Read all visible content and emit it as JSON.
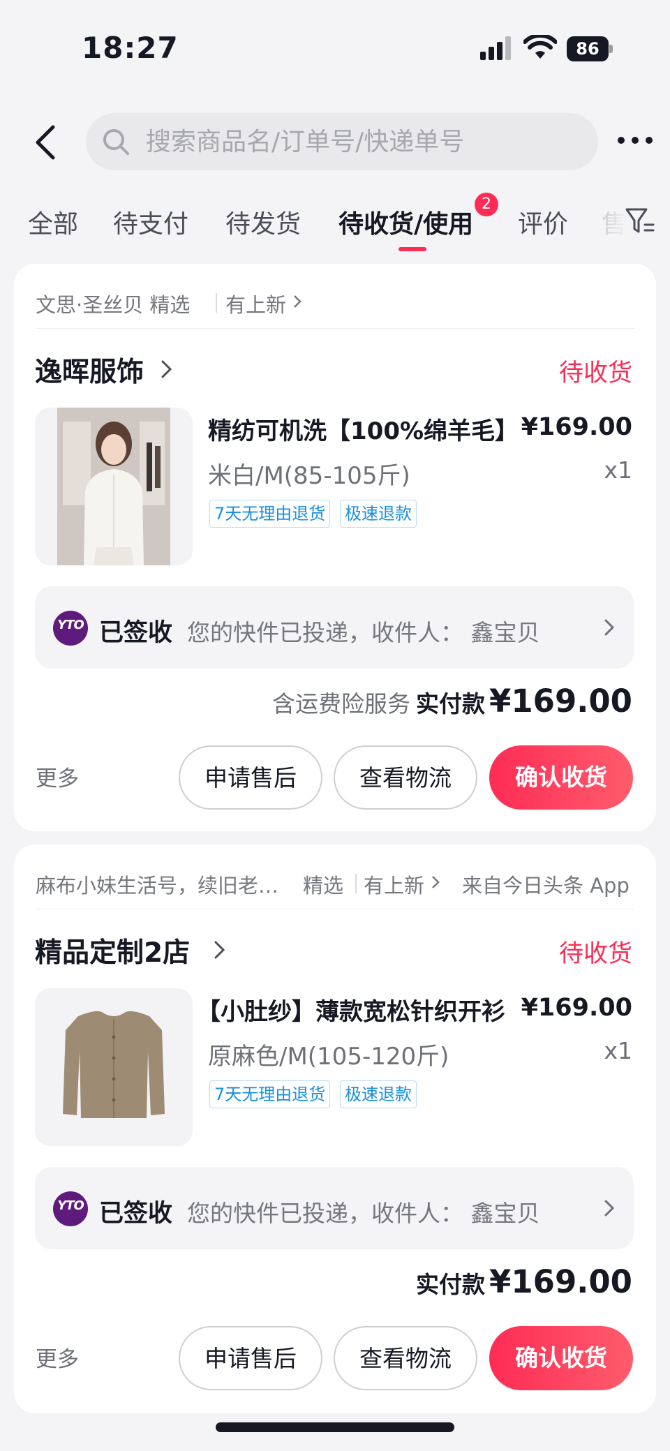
{
  "status_bar": {
    "time": "18:27",
    "battery": "86"
  },
  "search": {
    "placeholder": "搜索商品名/订单号/快递单号",
    "value": ""
  },
  "tabs": [
    {
      "label": "全部"
    },
    {
      "label": "待支付"
    },
    {
      "label": "待发货"
    },
    {
      "label": "待收货/使用",
      "active": true,
      "badge": "2"
    },
    {
      "label": "评价"
    },
    {
      "label": "售"
    }
  ],
  "orders": [
    {
      "source_parts": [
        "文思·圣丝贝 精选",
        "有上新"
      ],
      "shop": "逸晖服饰",
      "status": "待收货",
      "product": {
        "title": "精纺可机洗【100%绵羊毛】",
        "price": "¥169.00",
        "sku": "米白/M(85-105斤)",
        "qty": "x1",
        "tags": [
          "7天无理由退货",
          "极速退款"
        ]
      },
      "logistics": {
        "courier": "YTO",
        "status": "已签收",
        "message": "您的快件已投递，收件人： 鑫宝贝"
      },
      "total": {
        "note": "含运费险服务",
        "label": "实付款",
        "amount": "¥169.00"
      },
      "actions": {
        "more": "更多",
        "after_sale": "申请售后",
        "track": "查看物流",
        "confirm": "确认收货"
      }
    },
    {
      "source_parts": [
        "麻布小妹生活号，续旧老物件",
        "精选",
        "有上新",
        "来自今日头条 App"
      ],
      "shop": "精品定制2店",
      "status": "待收货",
      "product": {
        "title": "【小肚纱】薄款宽松针织开衫",
        "price": "¥169.00",
        "sku": "原麻色/M(105-120斤)",
        "qty": "x1",
        "tags": [
          "7天无理由退货",
          "极速退款"
        ]
      },
      "logistics": {
        "courier": "YTO",
        "status": "已签收",
        "message": "您的快件已投递，收件人： 鑫宝贝"
      },
      "total": {
        "note": "",
        "label": "实付款",
        "amount": "¥169.00"
      },
      "actions": {
        "more": "更多",
        "after_sale": "申请售后",
        "track": "查看物流",
        "confirm": "确认收货"
      }
    }
  ],
  "colors": {
    "accent": "#fe2c55",
    "tag_blue": "#1a8fe0",
    "courier_purple": "#5e1a7c"
  }
}
